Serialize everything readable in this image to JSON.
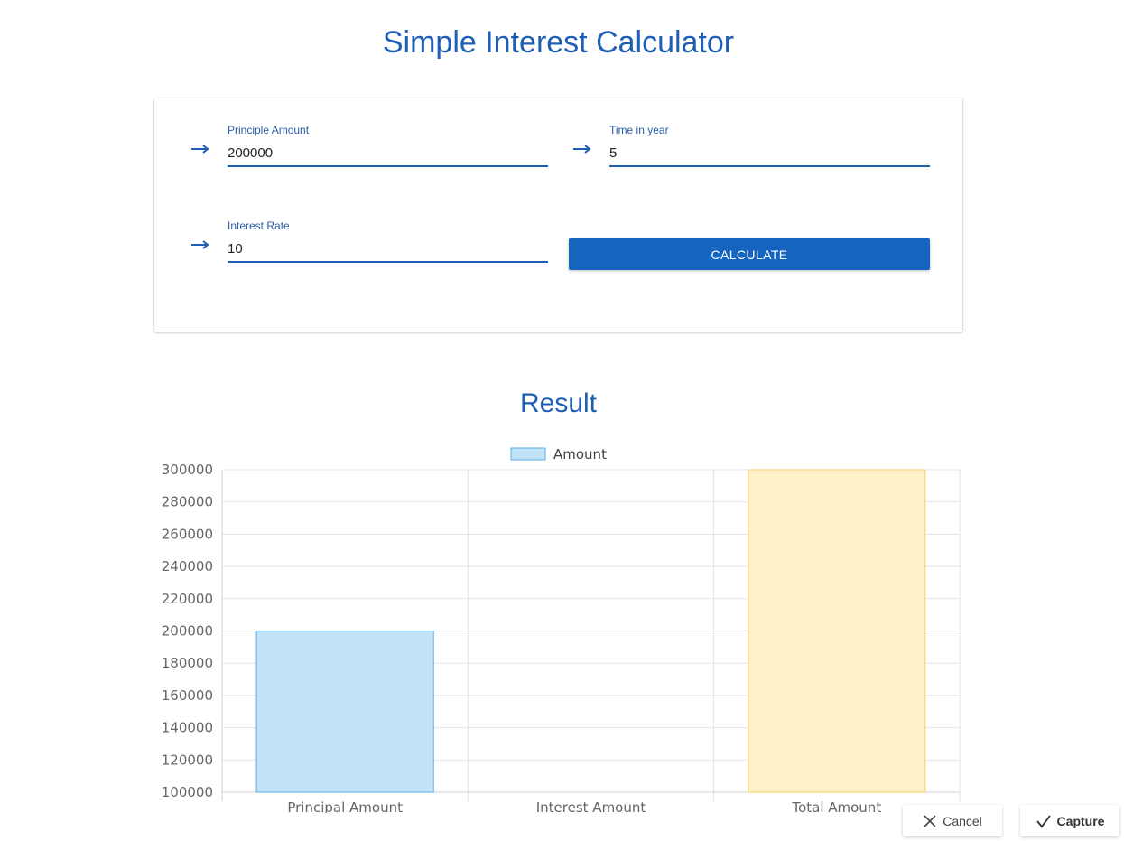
{
  "header": {
    "title": "Simple Interest Calculator"
  },
  "form": {
    "principal": {
      "label": "Principle Amount",
      "value": "200000",
      "icon": "arrow-right-icon"
    },
    "time": {
      "label": "Time in year",
      "value": "5",
      "icon": "arrow-right-icon"
    },
    "rate": {
      "label": "Interest Rate",
      "value": "10",
      "icon": "arrow-right-icon"
    },
    "calculate_label": "CALCULATE"
  },
  "result": {
    "title": "Result"
  },
  "chart_data": {
    "type": "bar",
    "categories": [
      "Principal Amount",
      "Interest Amount",
      "Total Amount"
    ],
    "series": [
      {
        "name": "Amount",
        "values": [
          200000,
          100000,
          300000
        ]
      }
    ],
    "ylim": [
      100000,
      300000
    ],
    "yticks": [
      100000,
      120000,
      140000,
      160000,
      180000,
      200000,
      220000,
      240000,
      260000,
      280000,
      300000
    ],
    "bar_colors": [
      "#c2e2f8",
      "#ffd9a8",
      "#fff0c9"
    ],
    "bar_borders": [
      "#5aaee6",
      "#f5b25c",
      "#f5cf6c"
    ],
    "grid": true,
    "legend": "top"
  },
  "actions": {
    "cancel_label": "Cancel",
    "capture_label": "Capture"
  },
  "colors": {
    "accent": "#1e5fb6",
    "button": "#1565c0"
  }
}
